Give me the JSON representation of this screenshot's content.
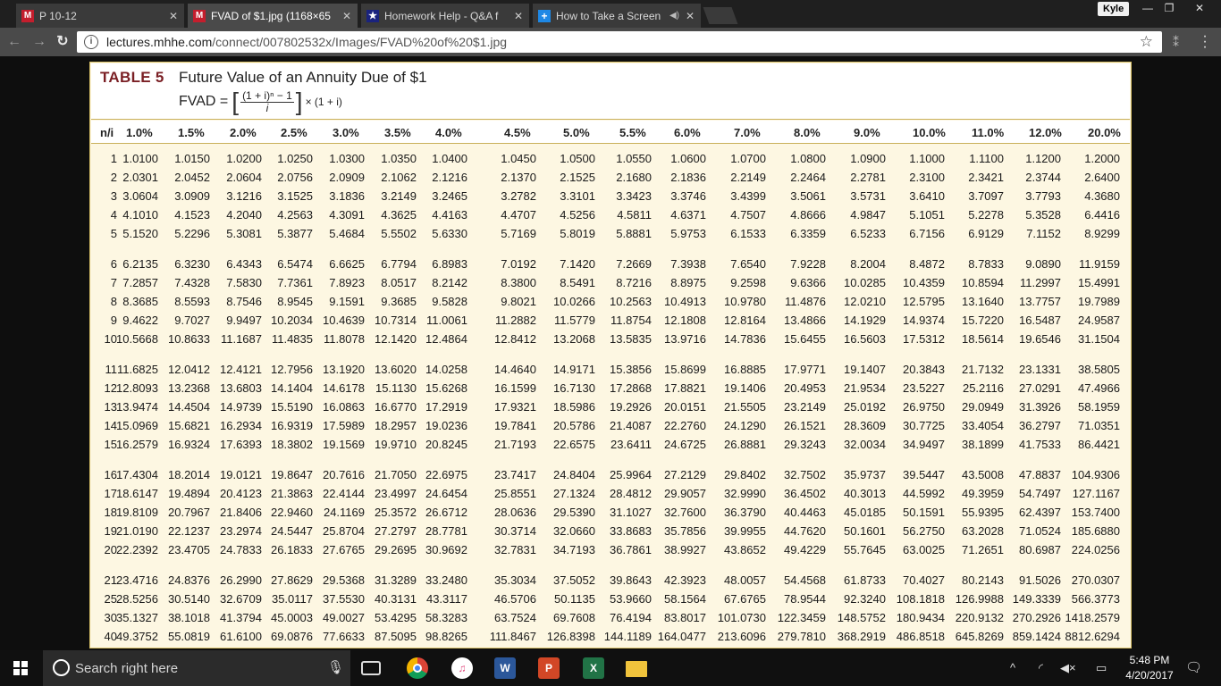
{
  "browser": {
    "tabs": [
      {
        "title": "P 10-12",
        "icon": "mcgraw-m-icon"
      },
      {
        "title": "FVAD of $1.jpg (1168×65",
        "icon": "mcgraw-m-icon"
      },
      {
        "title": "Homework Help - Q&A f",
        "icon": "star-icon"
      },
      {
        "title": "How to Take a Screen",
        "icon": "plus-icon"
      }
    ],
    "user": "Kyle",
    "url_host": "lectures.mhhe.com",
    "url_path": "/connect/007802532x/Images/FVAD%20of%20$1.jpg"
  },
  "table": {
    "label": "TABLE 5",
    "title": "Future Value of an Annuity Due of $1",
    "formula_lhs": "FVAD =",
    "formula_num": "(1 + i)ⁿ − 1",
    "formula_den": "i",
    "formula_tail": "× (1 + i)",
    "headers": [
      "n/i",
      "1.0%",
      "1.5%",
      "2.0%",
      "2.5%",
      "3.0%",
      "3.5%",
      "4.0%",
      "4.5%",
      "5.0%",
      "5.5%",
      "6.0%",
      "7.0%",
      "8.0%",
      "9.0%",
      "10.0%",
      "11.0%",
      "12.0%",
      "20.0%"
    ],
    "rows": [
      [
        "1",
        "1.0100",
        "1.0150",
        "1.0200",
        "1.0250",
        "1.0300",
        "1.0350",
        "1.0400",
        "1.0450",
        "1.0500",
        "1.0550",
        "1.0600",
        "1.0700",
        "1.0800",
        "1.0900",
        "1.1000",
        "1.1100",
        "1.1200",
        "1.2000"
      ],
      [
        "2",
        "2.0301",
        "2.0452",
        "2.0604",
        "2.0756",
        "2.0909",
        "2.1062",
        "2.1216",
        "2.1370",
        "2.1525",
        "2.1680",
        "2.1836",
        "2.2149",
        "2.2464",
        "2.2781",
        "2.3100",
        "2.3421",
        "2.3744",
        "2.6400"
      ],
      [
        "3",
        "3.0604",
        "3.0909",
        "3.1216",
        "3.1525",
        "3.1836",
        "3.2149",
        "3.2465",
        "3.2782",
        "3.3101",
        "3.3423",
        "3.3746",
        "3.4399",
        "3.5061",
        "3.5731",
        "3.6410",
        "3.7097",
        "3.7793",
        "4.3680"
      ],
      [
        "4",
        "4.1010",
        "4.1523",
        "4.2040",
        "4.2563",
        "4.3091",
        "4.3625",
        "4.4163",
        "4.4707",
        "4.5256",
        "4.5811",
        "4.6371",
        "4.7507",
        "4.8666",
        "4.9847",
        "5.1051",
        "5.2278",
        "5.3528",
        "6.4416"
      ],
      [
        "5",
        "5.1520",
        "5.2296",
        "5.3081",
        "5.3877",
        "5.4684",
        "5.5502",
        "5.6330",
        "5.7169",
        "5.8019",
        "5.8881",
        "5.9753",
        "6.1533",
        "6.3359",
        "6.5233",
        "6.7156",
        "6.9129",
        "7.1152",
        "8.9299"
      ],
      [
        "6",
        "6.2135",
        "6.3230",
        "6.4343",
        "6.5474",
        "6.6625",
        "6.7794",
        "6.8983",
        "7.0192",
        "7.1420",
        "7.2669",
        "7.3938",
        "7.6540",
        "7.9228",
        "8.2004",
        "8.4872",
        "8.7833",
        "9.0890",
        "11.9159"
      ],
      [
        "7",
        "7.2857",
        "7.4328",
        "7.5830",
        "7.7361",
        "7.8923",
        "8.0517",
        "8.2142",
        "8.3800",
        "8.5491",
        "8.7216",
        "8.8975",
        "9.2598",
        "9.6366",
        "10.0285",
        "10.4359",
        "10.8594",
        "11.2997",
        "15.4991"
      ],
      [
        "8",
        "8.3685",
        "8.5593",
        "8.7546",
        "8.9545",
        "9.1591",
        "9.3685",
        "9.5828",
        "9.8021",
        "10.0266",
        "10.2563",
        "10.4913",
        "10.9780",
        "11.4876",
        "12.0210",
        "12.5795",
        "13.1640",
        "13.7757",
        "19.7989"
      ],
      [
        "9",
        "9.4622",
        "9.7027",
        "9.9497",
        "10.2034",
        "10.4639",
        "10.7314",
        "11.0061",
        "11.2882",
        "11.5779",
        "11.8754",
        "12.1808",
        "12.8164",
        "13.4866",
        "14.1929",
        "14.9374",
        "15.7220",
        "16.5487",
        "24.9587"
      ],
      [
        "10",
        "10.5668",
        "10.8633",
        "11.1687",
        "11.4835",
        "11.8078",
        "12.1420",
        "12.4864",
        "12.8412",
        "13.2068",
        "13.5835",
        "13.9716",
        "14.7836",
        "15.6455",
        "16.5603",
        "17.5312",
        "18.5614",
        "19.6546",
        "31.1504"
      ],
      [
        "11",
        "11.6825",
        "12.0412",
        "12.4121",
        "12.7956",
        "13.1920",
        "13.6020",
        "14.0258",
        "14.4640",
        "14.9171",
        "15.3856",
        "15.8699",
        "16.8885",
        "17.9771",
        "19.1407",
        "20.3843",
        "21.7132",
        "23.1331",
        "38.5805"
      ],
      [
        "12",
        "12.8093",
        "13.2368",
        "13.6803",
        "14.1404",
        "14.6178",
        "15.1130",
        "15.6268",
        "16.1599",
        "16.7130",
        "17.2868",
        "17.8821",
        "19.1406",
        "20.4953",
        "21.9534",
        "23.5227",
        "25.2116",
        "27.0291",
        "47.4966"
      ],
      [
        "13",
        "13.9474",
        "14.4504",
        "14.9739",
        "15.5190",
        "16.0863",
        "16.6770",
        "17.2919",
        "17.9321",
        "18.5986",
        "19.2926",
        "20.0151",
        "21.5505",
        "23.2149",
        "25.0192",
        "26.9750",
        "29.0949",
        "31.3926",
        "58.1959"
      ],
      [
        "14",
        "15.0969",
        "15.6821",
        "16.2934",
        "16.9319",
        "17.5989",
        "18.2957",
        "19.0236",
        "19.7841",
        "20.5786",
        "21.4087",
        "22.2760",
        "24.1290",
        "26.1521",
        "28.3609",
        "30.7725",
        "33.4054",
        "36.2797",
        "71.0351"
      ],
      [
        "15",
        "16.2579",
        "16.9324",
        "17.6393",
        "18.3802",
        "19.1569",
        "19.9710",
        "20.8245",
        "21.7193",
        "22.6575",
        "23.6411",
        "24.6725",
        "26.8881",
        "29.3243",
        "32.0034",
        "34.9497",
        "38.1899",
        "41.7533",
        "86.4421"
      ],
      [
        "16",
        "17.4304",
        "18.2014",
        "19.0121",
        "19.8647",
        "20.7616",
        "21.7050",
        "22.6975",
        "23.7417",
        "24.8404",
        "25.9964",
        "27.2129",
        "29.8402",
        "32.7502",
        "35.9737",
        "39.5447",
        "43.5008",
        "47.8837",
        "104.9306"
      ],
      [
        "17",
        "18.6147",
        "19.4894",
        "20.4123",
        "21.3863",
        "22.4144",
        "23.4997",
        "24.6454",
        "25.8551",
        "27.1324",
        "28.4812",
        "29.9057",
        "32.9990",
        "36.4502",
        "40.3013",
        "44.5992",
        "49.3959",
        "54.7497",
        "127.1167"
      ],
      [
        "18",
        "19.8109",
        "20.7967",
        "21.8406",
        "22.9460",
        "24.1169",
        "25.3572",
        "26.6712",
        "28.0636",
        "29.5390",
        "31.1027",
        "32.7600",
        "36.3790",
        "40.4463",
        "45.0185",
        "50.1591",
        "55.9395",
        "62.4397",
        "153.7400"
      ],
      [
        "19",
        "21.0190",
        "22.1237",
        "23.2974",
        "24.5447",
        "25.8704",
        "27.2797",
        "28.7781",
        "30.3714",
        "32.0660",
        "33.8683",
        "35.7856",
        "39.9955",
        "44.7620",
        "50.1601",
        "56.2750",
        "63.2028",
        "71.0524",
        "185.6880"
      ],
      [
        "20",
        "22.2392",
        "23.4705",
        "24.7833",
        "26.1833",
        "27.6765",
        "29.2695",
        "30.9692",
        "32.7831",
        "34.7193",
        "36.7861",
        "38.9927",
        "43.8652",
        "49.4229",
        "55.7645",
        "63.0025",
        "71.2651",
        "80.6987",
        "224.0256"
      ],
      [
        "21",
        "23.4716",
        "24.8376",
        "26.2990",
        "27.8629",
        "29.5368",
        "31.3289",
        "33.2480",
        "35.3034",
        "37.5052",
        "39.8643",
        "42.3923",
        "48.0057",
        "54.4568",
        "61.8733",
        "70.4027",
        "80.2143",
        "91.5026",
        "270.0307"
      ],
      [
        "25",
        "28.5256",
        "30.5140",
        "32.6709",
        "35.0117",
        "37.5530",
        "40.3131",
        "43.3117",
        "46.5706",
        "50.1135",
        "53.9660",
        "58.1564",
        "67.6765",
        "78.9544",
        "92.3240",
        "108.1818",
        "126.9988",
        "149.3339",
        "566.3773"
      ],
      [
        "30",
        "35.1327",
        "38.1018",
        "41.3794",
        "45.0003",
        "49.0027",
        "53.4295",
        "58.3283",
        "63.7524",
        "69.7608",
        "76.4194",
        "83.8017",
        "101.0730",
        "122.3459",
        "148.5752",
        "180.9434",
        "220.9132",
        "270.2926",
        "1418.2579"
      ],
      [
        "40",
        "49.3752",
        "55.0819",
        "61.6100",
        "69.0876",
        "77.6633",
        "87.5095",
        "98.8265",
        "111.8467",
        "126.8398",
        "144.1189",
        "164.0477",
        "213.6096",
        "279.7810",
        "368.2919",
        "486.8518",
        "645.8269",
        "859.1424",
        "8812.6294"
      ]
    ]
  },
  "taskbar": {
    "search_placeholder": "Search right here",
    "apps": [
      "task-view-icon",
      "chrome-icon",
      "itunes-icon",
      "word-icon",
      "powerpoint-icon",
      "excel-icon",
      "file-explorer-icon"
    ],
    "time": "5:48 PM",
    "date": "4/20/2017"
  }
}
